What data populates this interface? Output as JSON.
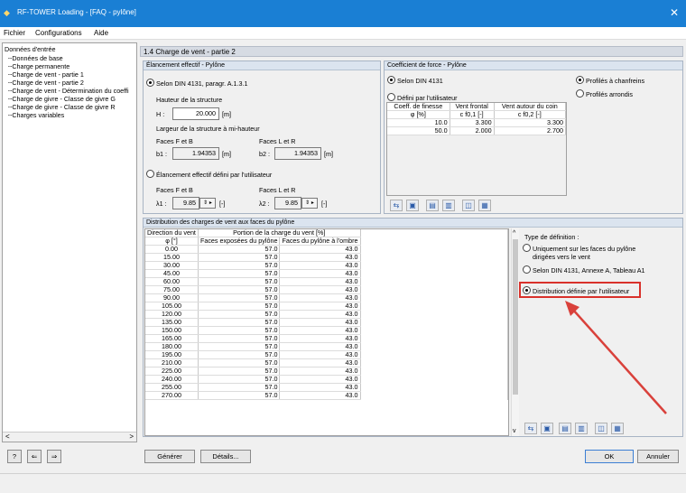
{
  "window": {
    "title": "RF-TOWER Loading - [FAQ - pylône]",
    "close_glyph": "✕"
  },
  "menu": {
    "items": [
      "Fichier",
      "Configurations",
      "Aide"
    ]
  },
  "nav": {
    "root": "Données d'entrée",
    "items": [
      "Données de base",
      "Charge permanente",
      "Charge de vent - partie 1",
      "Charge de vent - partie 2",
      "Charge de vent - Détermination du coeffi",
      "Charge de givre - Classe de givre G",
      "Charge de givre - Classe de givre R",
      "Charges variables"
    ],
    "scroll_left": "<",
    "scroll_right": ">"
  },
  "header": {
    "title": "1.4 Charge de vent - partie 2"
  },
  "slenderness": {
    "title": "Élancement effectif - Pylône",
    "option1": "Selon DIN 4131, paragr. A.1.3.1",
    "height_label": "Hauteur de la structure",
    "h_label": "H :",
    "h_value": "20.000",
    "h_unit": "[m]",
    "width_label": "Largeur de la structure à mi-hauteur",
    "faces_fb": "Faces F et B",
    "faces_lr": "Faces L et R",
    "b1_label": "b1 :",
    "b1_value": "1.94353",
    "b1_unit": "[m]",
    "b2_label": "b2 :",
    "b2_value": "1.94353",
    "b2_unit": "[m]",
    "option2": "Élancement effectif défini par l'utilisateur",
    "faces_fb2": "Faces F et B",
    "faces_lr2": "Faces L et R",
    "l1_label": "λ1 :",
    "l1_value": "9.85",
    "l1_unit": "[-]",
    "l2_label": "λ2 :",
    "l2_value": "9.85",
    "l2_unit": "[-]"
  },
  "force": {
    "title": "Coefficient de force - Pylône",
    "option1": "Selon DIN 4131",
    "option2": "Défini par l'utilisateur",
    "option3": "Profilés à chanfreins",
    "option4": "Profilés arrondis",
    "col1": "Coeff. de finesse",
    "col1_sub": "φ [%]",
    "col2": "Vent frontal",
    "col2_sub": "c f0,1 [-]",
    "col3": "Vent autour du coin",
    "col3_sub": "c f0,2 [-]",
    "rows": [
      [
        "10.0",
        "3.300",
        "3.300"
      ],
      [
        "50.0",
        "2.000",
        "2.700"
      ]
    ]
  },
  "distribution": {
    "title": "Distribution des charges de vent aux faces du pylône",
    "col1": "Direction du vent",
    "col1_sub": "φ [°]",
    "group_header": "Portion de la charge du vent [%]",
    "col2": "Faces exposées du pylône",
    "col3": "Faces du pylône à l'ombre",
    "rows": [
      [
        "0.00",
        "57.0",
        "43.0"
      ],
      [
        "15.00",
        "57.0",
        "43.0"
      ],
      [
        "30.00",
        "57.0",
        "43.0"
      ],
      [
        "45.00",
        "57.0",
        "43.0"
      ],
      [
        "60.00",
        "57.0",
        "43.0"
      ],
      [
        "75.00",
        "57.0",
        "43.0"
      ],
      [
        "90.00",
        "57.0",
        "43.0"
      ],
      [
        "105.00",
        "57.0",
        "43.0"
      ],
      [
        "120.00",
        "57.0",
        "43.0"
      ],
      [
        "135.00",
        "57.0",
        "43.0"
      ],
      [
        "150.00",
        "57.0",
        "43.0"
      ],
      [
        "165.00",
        "57.0",
        "43.0"
      ],
      [
        "180.00",
        "57.0",
        "43.0"
      ],
      [
        "195.00",
        "57.0",
        "43.0"
      ],
      [
        "210.00",
        "57.0",
        "43.0"
      ],
      [
        "225.00",
        "57.0",
        "43.0"
      ],
      [
        "240.00",
        "57.0",
        "43.0"
      ],
      [
        "255.00",
        "57.0",
        "43.0"
      ],
      [
        "270.00",
        "57.0",
        "43.0"
      ]
    ],
    "scroll_up": "^",
    "scroll_down": "v"
  },
  "definition": {
    "title": "Type de définition :",
    "option1_line1": "Uniquement sur les faces du pylône",
    "option1_line2": "dirigées vers le vent",
    "option2": "Selon DIN 4131, Annexe A, Tableau A1",
    "option3": "Distribution définie par l'utilisateur"
  },
  "buttons": {
    "generate": "Générer",
    "details": "Détails...",
    "ok": "OK",
    "cancel": "Annuler"
  },
  "colors": {
    "titlebar": "#1a7fd4",
    "highlight": "#d9312b",
    "arrow": "#d9413b"
  }
}
